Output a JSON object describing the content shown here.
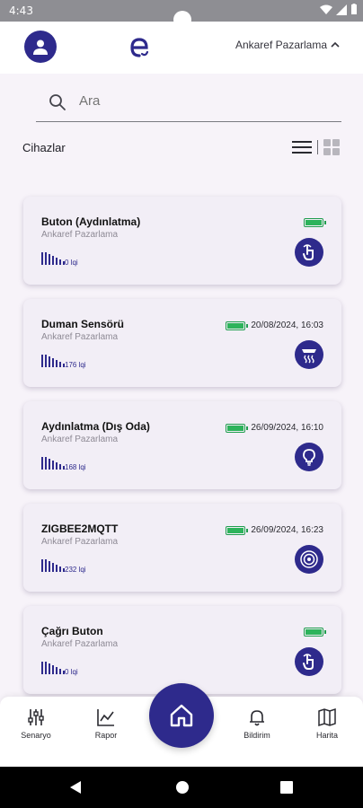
{
  "status_bar": {
    "time": "4:43"
  },
  "header": {
    "org_name": "Ankaref Pazarlama"
  },
  "search": {
    "placeholder": "Ara"
  },
  "list": {
    "title": "Cihazlar"
  },
  "devices": [
    {
      "name": "Buton (Aydınlatma)",
      "org": "Ankaref Pazarlama",
      "timestamp": "",
      "signal": "0 lqi",
      "icon": "touch-button-icon"
    },
    {
      "name": "Duman Sensörü",
      "org": "Ankaref Pazarlama",
      "timestamp": "20/08/2024, 16:03",
      "signal": "176 lqi",
      "icon": "smoke-sensor-icon"
    },
    {
      "name": "Aydınlatma (Dış Oda)",
      "org": "Ankaref Pazarlama",
      "timestamp": "26/09/2024, 16:10",
      "signal": "168 lqi",
      "icon": "light-bulb-icon"
    },
    {
      "name": "ZIGBEE2MQTT",
      "org": "Ankaref Pazarlama",
      "timestamp": "26/09/2024, 16:23",
      "signal": "232 lqi",
      "icon": "hub-icon"
    },
    {
      "name": "Çağrı Buton",
      "org": "Ankaref Pazarlama",
      "timestamp": "",
      "signal": "0 lqi",
      "icon": "touch-button-icon"
    }
  ],
  "bottom_nav": {
    "scenario": "Senaryo",
    "report": "Rapor",
    "notification": "Bildirim",
    "map": "Harita"
  },
  "colors": {
    "accent": "#2e2a8c",
    "battery": "#2db35b",
    "background": "#f7f3f9"
  }
}
